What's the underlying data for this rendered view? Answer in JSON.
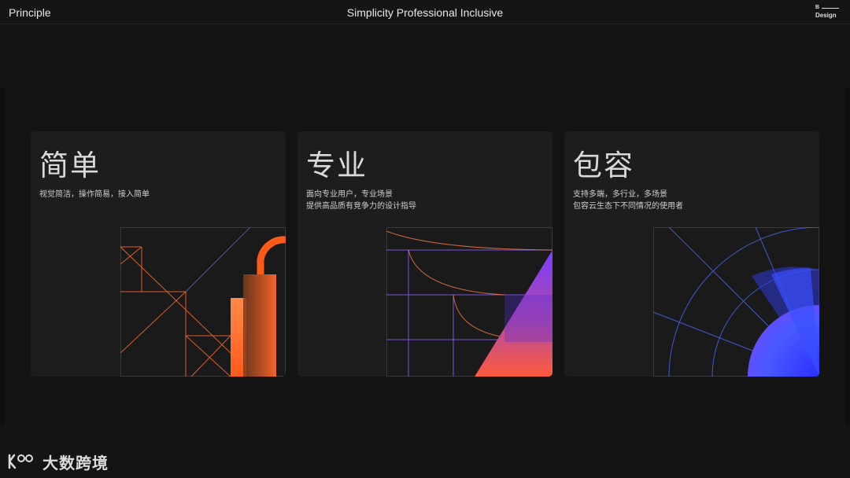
{
  "header": {
    "brand": "Principle",
    "tagline": "Simplicity Professional Inclusive",
    "logo": {
      "top": "B",
      "bottom": "Design"
    }
  },
  "cards": [
    {
      "title": "简单",
      "lines": [
        "视觉简洁，操作简易，接入简单"
      ],
      "accent": "#ff6a2a"
    },
    {
      "title": "专业",
      "lines": [
        "面向专业用户，专业场景",
        "提供高品质有竞争力的设计指导"
      ],
      "accent": "#8a4bff"
    },
    {
      "title": "包容",
      "lines": [
        "支持多端，多行业，多场景",
        "包容云生态下不同情况的使用者"
      ],
      "accent": "#3a4dff"
    }
  ],
  "watermark": {
    "text": "大数跨境"
  },
  "colors": {
    "background": "#141414",
    "card": "#1d1d1e"
  }
}
